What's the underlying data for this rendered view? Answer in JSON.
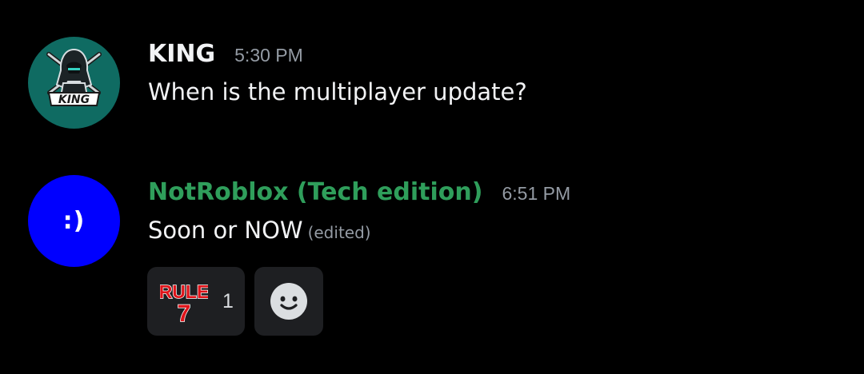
{
  "messages": [
    {
      "username": "KING",
      "timestamp": "5:30 PM",
      "content": "When is the multiplayer update?",
      "avatar_text": "KING",
      "avatar_color": "#0f6b62"
    },
    {
      "username": "NotRoblox (Tech edition)",
      "username_color": "#2f9e5b",
      "timestamp": "6:51 PM",
      "content": "Soon or NOW",
      "edited_label": "(edited)",
      "avatar_text": ":)",
      "avatar_color": "#0000ff",
      "reactions": [
        {
          "emoji": "rule-7-emoji",
          "line1": "RULE",
          "line2": "7",
          "count": "1"
        },
        {
          "emoji": "add-reaction-smiley-icon"
        }
      ]
    }
  ],
  "colors": {
    "background": "#000000",
    "text": "#f2f3f5",
    "muted": "#949ba4",
    "reaction_bg": "#1e1f22"
  }
}
